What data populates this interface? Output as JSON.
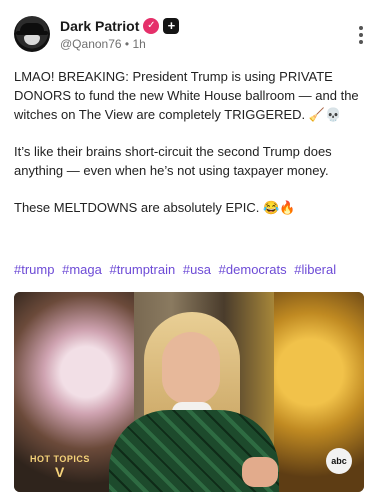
{
  "author": {
    "display_name": "Dark Patriot",
    "handle": "@Qanon76",
    "separator": "•",
    "time_ago": "1h",
    "verified_glyph": "✓",
    "plus_glyph": "+"
  },
  "post": {
    "paragraphs": [
      "LMAO! BREAKING: President Trump is using PRIVATE DONORS to fund the new White House ballroom — and the witches on The View are completely TRIGGERED. 🧹💀",
      "It’s like their brains short-circuit the second Trump does anything — even when he’s not using taxpayer money.",
      "These MELTDOWNS are absolutely EPIC. 😂🔥"
    ],
    "hashtags": [
      "#trump",
      "#maga",
      "#trumptrain",
      "#usa",
      "#democrats",
      "#liberal"
    ]
  },
  "media": {
    "show_logo_small": "HOT TOPICS",
    "show_logo_big": "V",
    "network_logo": "abc"
  },
  "colors": {
    "hashtag": "#6d4bd6",
    "verified": "#e5306a"
  }
}
